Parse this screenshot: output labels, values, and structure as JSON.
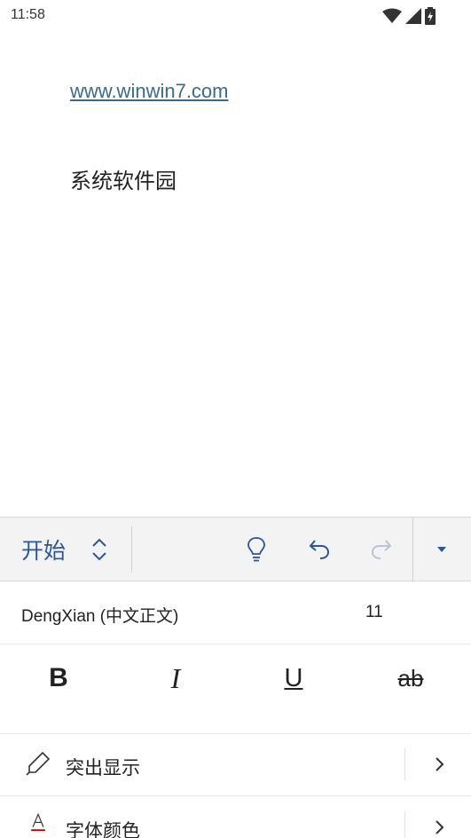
{
  "status_bar": {
    "time": "11:58",
    "icons": [
      "wifi-icon",
      "cell-signal-icon",
      "battery-icon"
    ]
  },
  "document": {
    "link_text": "www.winwin7.com",
    "body_text": "系统软件园"
  },
  "ribbon": {
    "tab_label": "开始",
    "buttons": [
      "lightbulb-icon",
      "undo-icon",
      "redo-icon",
      "dropdown-caret-icon"
    ]
  },
  "font_row": {
    "font_name": "DengXian (中文正文)",
    "font_size": "11"
  },
  "format_row": {
    "bold": "B",
    "italic": "I",
    "underline": "U",
    "strikethrough": "ab"
  },
  "list": {
    "highlight_label": "突出显示",
    "font_color_label": "字体颜色"
  },
  "colors": {
    "accent": "#2b579a",
    "link": "#3a6b8a",
    "ribbon_bg": "#f3f3f3",
    "font_color_underline": "#c00000"
  }
}
